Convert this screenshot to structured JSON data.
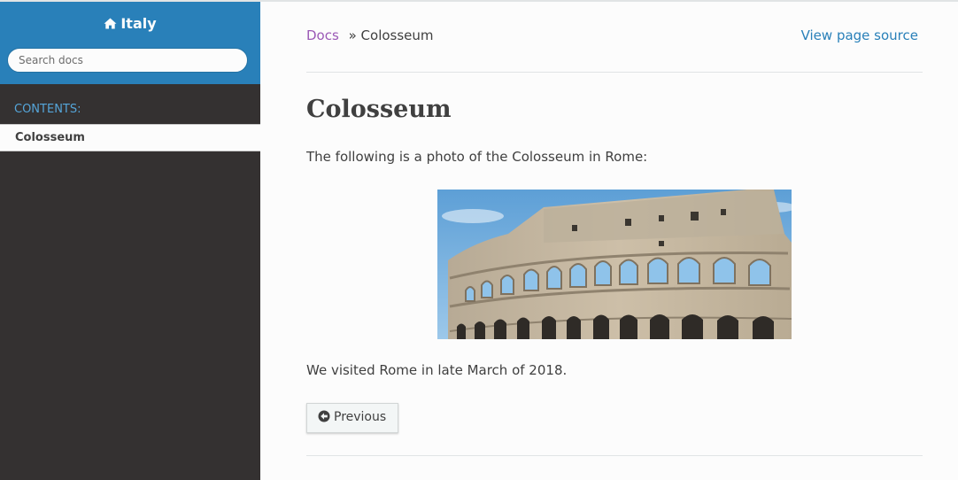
{
  "sidebar": {
    "project_title": "Italy",
    "search": {
      "placeholder": "Search docs",
      "value": ""
    },
    "caption": "CONTENTS:",
    "items": [
      {
        "label": "Colosseum",
        "current": true
      }
    ]
  },
  "breadcrumb": {
    "root": "Docs",
    "separator": "»",
    "current": "Colosseum",
    "view_source": "View page source"
  },
  "page": {
    "title": "Colosseum",
    "intro": "The following is a photo of the Colosseum in Rome:",
    "outro": "We visited Rome in late March of 2018."
  },
  "footer_nav": {
    "previous_label": "Previous"
  },
  "colors": {
    "header_blue": "#2980b9",
    "sidebar_dark": "#343131",
    "link_blue": "#2980b9",
    "visited_purple": "#9b59b6",
    "caption_blue": "#55a5d9",
    "content_bg": "#fcfcfc"
  },
  "icons": {
    "home": "home-icon",
    "previous": "circle-arrow-left-icon"
  }
}
